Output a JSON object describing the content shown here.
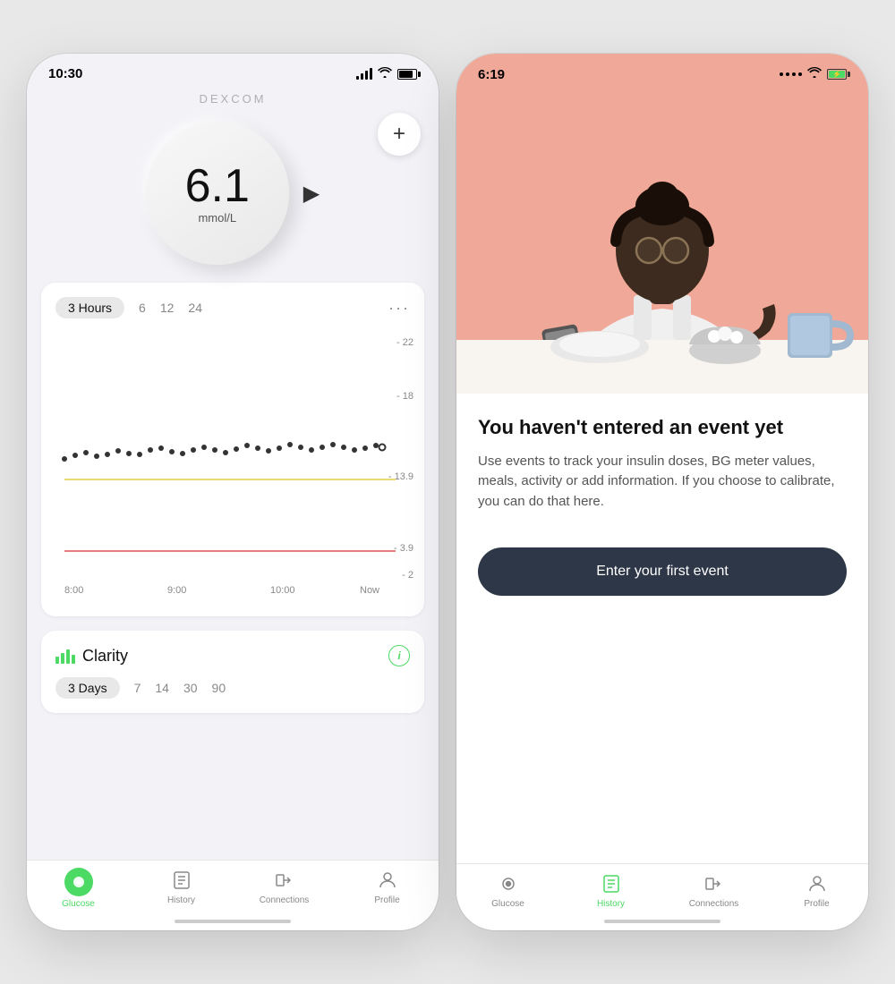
{
  "left_phone": {
    "status": {
      "time": "10:30"
    },
    "brand": "DEXCOM",
    "glucose": {
      "value": "6.1",
      "unit": "mmol/L"
    },
    "add_button": "+",
    "chart": {
      "tabs": [
        "3 Hours",
        "6",
        "12",
        "24"
      ],
      "active_tab": "3 Hours",
      "y_labels": [
        "22",
        "18",
        "13.9",
        "3.9",
        "2"
      ],
      "x_labels": [
        "8:00",
        "9:00",
        "10:00",
        "Now"
      ]
    },
    "clarity": {
      "title": "Clarity",
      "tabs": [
        "3 Days",
        "7",
        "14",
        "30",
        "90"
      ],
      "active_tab": "3 Days"
    },
    "nav": {
      "items": [
        {
          "label": "Glucose",
          "active": true
        },
        {
          "label": "History",
          "active": false
        },
        {
          "label": "Connections",
          "active": false
        },
        {
          "label": "Profile",
          "active": false
        }
      ]
    }
  },
  "right_phone": {
    "status": {
      "time": "6:19"
    },
    "event": {
      "title": "You haven't entered an event yet",
      "description": "Use events to track your insulin doses, BG meter values, meals, activity or add information. If you choose to calibrate, you can do that here.",
      "button_label": "Enter your first event"
    },
    "nav": {
      "items": [
        {
          "label": "Glucose",
          "active": false
        },
        {
          "label": "History",
          "active": true
        },
        {
          "label": "Connections",
          "active": false
        },
        {
          "label": "Profile",
          "active": false
        }
      ]
    }
  }
}
